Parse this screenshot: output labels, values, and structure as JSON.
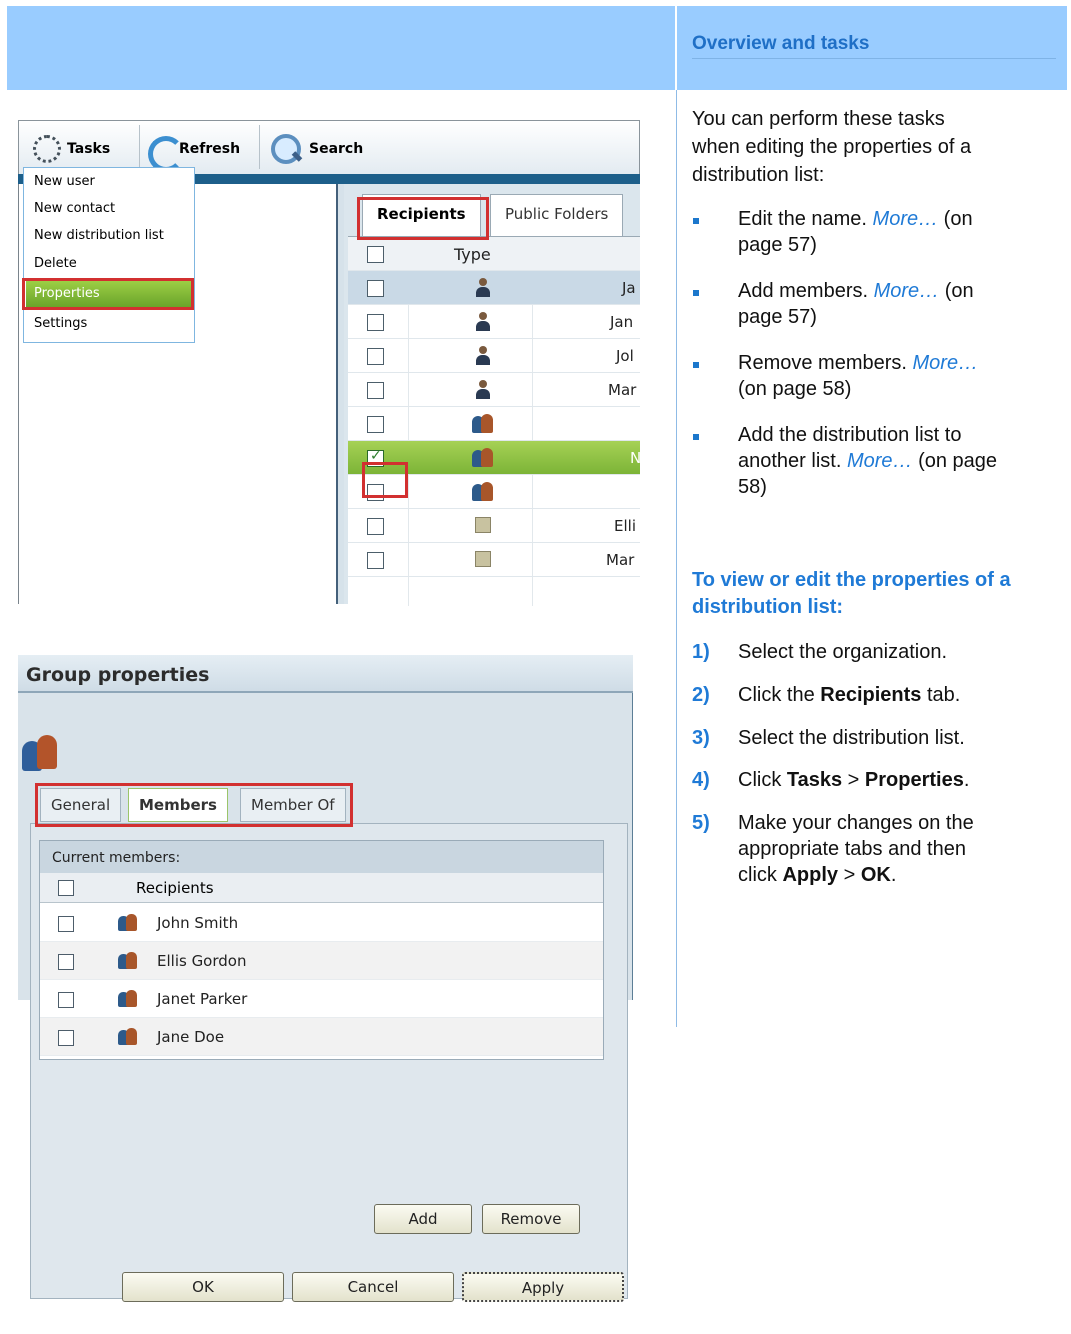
{
  "header": {
    "title": "Overview and tasks"
  },
  "screenshot1": {
    "toolbar": {
      "tasks": "Tasks",
      "refresh": "Refresh",
      "search": "Search"
    },
    "menu": [
      "New user",
      "New contact",
      "New distribution list",
      "Delete",
      "Properties",
      "Settings"
    ],
    "tabs": {
      "recipients": "Recipients",
      "public_folders": "Public Folders"
    },
    "table_header": {
      "type": "Type"
    },
    "rows": [
      {
        "icon": "person-icon",
        "text": "Ja",
        "checked": false
      },
      {
        "icon": "person-icon",
        "text": "Jan",
        "checked": false
      },
      {
        "icon": "person-icon",
        "text": "Jol",
        "checked": false
      },
      {
        "icon": "person-icon",
        "text": "Mar",
        "checked": false
      },
      {
        "icon": "group-icon",
        "text": "",
        "checked": false
      },
      {
        "icon": "group-icon",
        "text": "N",
        "checked": true
      },
      {
        "icon": "group-icon",
        "text": "",
        "checked": false
      },
      {
        "icon": "contact-icon",
        "text": "Elli",
        "checked": false
      },
      {
        "icon": "contact-icon",
        "text": "Mar",
        "checked": false
      }
    ]
  },
  "screenshot2": {
    "title": "Group properties",
    "tabs": [
      "General",
      "Members",
      "Member Of"
    ],
    "caption": "Current members:",
    "column": "Recipients",
    "members": [
      "John Smith",
      "Ellis Gordon",
      "Janet Parker",
      "Jane Doe"
    ],
    "buttons": {
      "add": "Add",
      "remove": "Remove",
      "ok": "OK",
      "cancel": "Cancel",
      "apply": "Apply"
    }
  },
  "content": {
    "intro": [
      "You can perform these tasks",
      "when editing the properties of a",
      "distribution list:"
    ],
    "tasks": [
      {
        "lines": [
          "Edit the name. ",
          "More…",
          " (on",
          "page 57)"
        ]
      },
      {
        "lines": [
          "Add members. ",
          "More…",
          " (on",
          "page 57)"
        ]
      },
      {
        "lines": [
          "Remove members. ",
          "More…",
          "",
          "(on page 58)"
        ]
      },
      {
        "lines": [
          "Add the distribution list to",
          "another list. ",
          "More…",
          " (on page",
          "58)"
        ]
      }
    ],
    "procedure_heading": "To view or edit the properties of a distribution list:",
    "steps": [
      {
        "num": "1)",
        "text": "Select the organization."
      },
      {
        "num": "2)",
        "pre": "Click the ",
        "bold": "Recipients",
        "post": " tab."
      },
      {
        "num": "3)",
        "text": "Select the distribution list."
      },
      {
        "num": "4)",
        "pre": "Click ",
        "bold": "Tasks",
        "mid": " > ",
        "bold2": "Properties",
        "post": "."
      },
      {
        "num": "5)",
        "line1": "Make your changes on the",
        "line2": "appropriate tabs and then",
        "pre3": "click ",
        "bold": "Apply",
        "mid": " > ",
        "bold2": "OK",
        "post": "."
      }
    ]
  }
}
